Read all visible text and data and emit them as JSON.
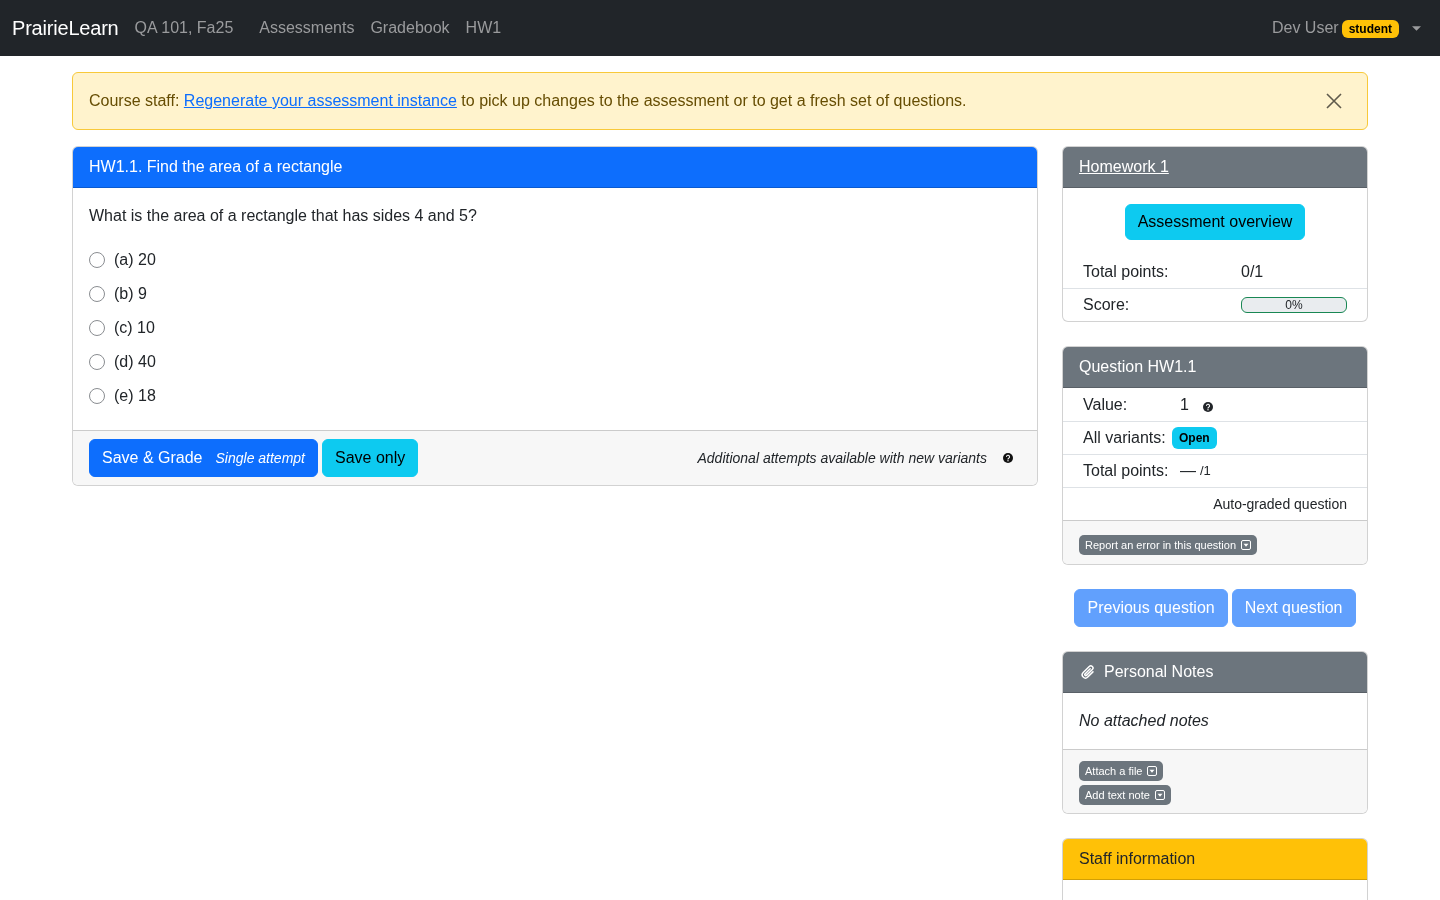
{
  "navbar": {
    "brand": "PrairieLearn",
    "course": "QA 101, Fa25",
    "links": [
      "Assessments",
      "Gradebook",
      "HW1"
    ],
    "user": {
      "name": "Dev User",
      "role_badge": "student"
    }
  },
  "alert": {
    "prefix": "Course staff:",
    "link": "Regenerate your assessment instance",
    "text": "to pick up changes to the assessment or to get a fresh set of questions."
  },
  "question_card": {
    "title": "HW1.1. Find the area of a rectangle",
    "prompt": "What is the area of a rectangle that has sides 4 and 5?",
    "options": [
      {
        "label": "(a) 20",
        "selected": false
      },
      {
        "label": "(b) 9",
        "selected": false
      },
      {
        "label": "(c) 10",
        "selected": false
      },
      {
        "label": "(d) 40",
        "selected": false
      },
      {
        "label": "(e) 18",
        "selected": false
      }
    ],
    "footer": {
      "grade_button": {
        "label": "Save & Grade",
        "note": "Single attempt"
      },
      "save_button": "Save only",
      "attempts_note": "Additional attempts available with new variants"
    }
  },
  "assessment_card": {
    "title": "Homework 1",
    "overview_button": "Assessment overview",
    "rows": [
      {
        "kind": "text",
        "label": "Total points:",
        "value": "0/1"
      },
      {
        "kind": "progress",
        "label": "Score:",
        "level": 0,
        "reading": "0%"
      }
    ]
  },
  "question_info_card": {
    "title": "Question HW1.1",
    "rows": [
      {
        "kind": "help",
        "label": "Value:",
        "value": "1"
      },
      {
        "kind": "badge",
        "label": "All variants:",
        "value": "Open"
      },
      {
        "kind": "points",
        "label": "Total points:",
        "value": "—",
        "max": "/1"
      },
      {
        "kind": "note",
        "value": "Auto-graded question"
      }
    ],
    "footer_button": "Report an error in this question"
  },
  "nav_buttons": [
    {
      "label": "Previous question",
      "disabled": true
    },
    {
      "label": "Next question",
      "disabled": true
    }
  ],
  "notes_card": {
    "title": "Personal Notes",
    "empty_text": "No attached notes",
    "buttons": [
      "Attach a file",
      "Add text note"
    ]
  },
  "staff_card": {
    "title": "Staff information"
  }
}
